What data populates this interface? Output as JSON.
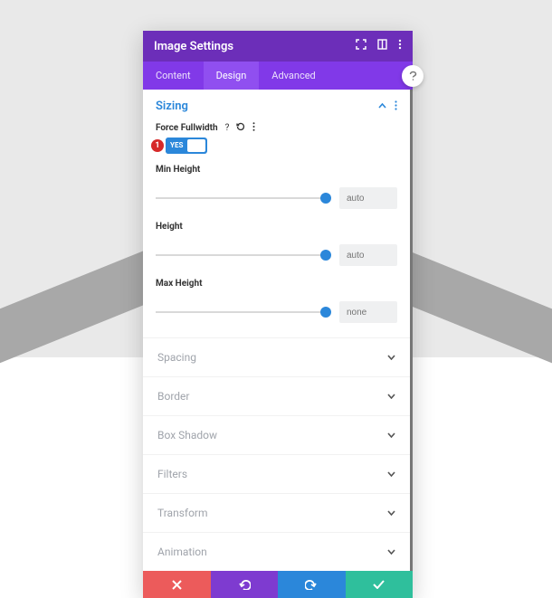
{
  "header": {
    "title": "Image Settings"
  },
  "tabs": {
    "content": "Content",
    "design": "Design",
    "advanced": "Advanced"
  },
  "sizing": {
    "title": "Sizing",
    "force_fullwidth_label": "Force Fullwidth",
    "toggle_yes": "YES",
    "badge": "1",
    "min_height_label": "Min Height",
    "min_height_value": "auto",
    "height_label": "Height",
    "height_value": "auto",
    "max_height_label": "Max Height",
    "max_height_value": "none"
  },
  "accordion": {
    "spacing": "Spacing",
    "border": "Border",
    "box_shadow": "Box Shadow",
    "filters": "Filters",
    "transform": "Transform",
    "animation": "Animation"
  }
}
